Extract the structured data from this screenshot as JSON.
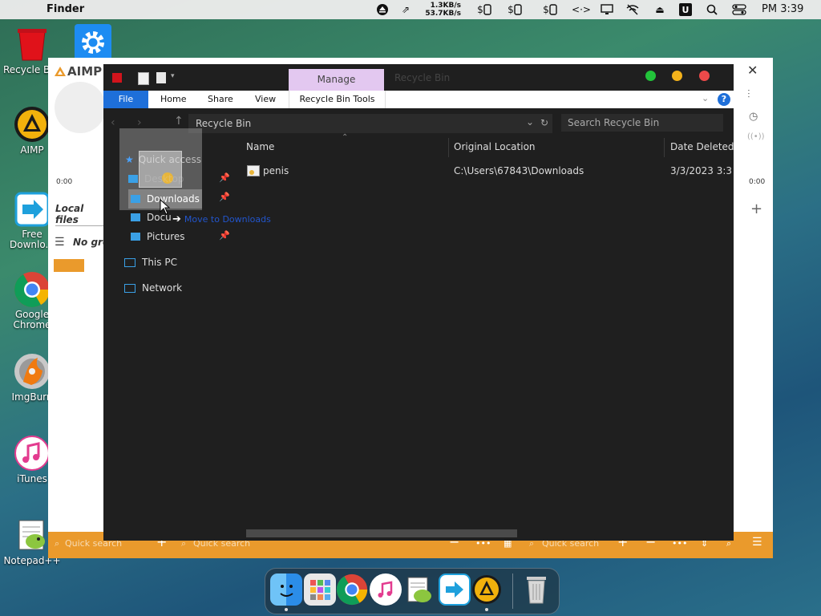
{
  "menubar": {
    "app_name": "Finder",
    "net_up": "1.3KB/s",
    "net_down": "53.7KB/s",
    "clock": "PM 3:39"
  },
  "desktop": {
    "icons": [
      {
        "label": "Recycle Bin"
      },
      {
        "label": "AIMP"
      },
      {
        "label": "Free Downlo..."
      },
      {
        "label": "Google Chrome"
      },
      {
        "label": "ImgBurn"
      },
      {
        "label": "iTunes"
      },
      {
        "label": "Notepad++"
      }
    ]
  },
  "aimp": {
    "logo": "AIMP",
    "time_left": "0:00",
    "time_right": "0:00",
    "local_files": "Local files",
    "no_group": "No gro",
    "quick_search_1": "Quick search",
    "quick_search_2": "Quick search",
    "quick_search_3": "Quick search"
  },
  "explorer": {
    "manage_tab": "Manage",
    "window_title": "Recycle Bin",
    "tabs": [
      "File",
      "Home",
      "Share",
      "View",
      "Recycle Bin Tools"
    ],
    "address": "Recycle Bin",
    "search_placeholder": "Search Recycle Bin",
    "nav": {
      "quick_access": "Quick access",
      "desktop": "Desktop",
      "downloads": "Downloads",
      "documents": "Docu",
      "pictures": "Pictures",
      "this_pc": "This PC",
      "network": "Network"
    },
    "drag_tooltip": "Move to Downloads",
    "columns": [
      "Name",
      "Original Location",
      "Date Deleted"
    ],
    "rows": [
      {
        "name": "penis",
        "location": "C:\\Users\\67843\\Downloads",
        "date": "3/3/2023 3:3"
      }
    ]
  },
  "colors": {
    "accent_orange": "#ea9a2c",
    "manage_purple": "#e3c8f0",
    "selected_blue": "#1e6fd9",
    "traffic_green": "#22c33a",
    "traffic_yellow": "#f3b21b",
    "traffic_red": "#ee4a4a"
  }
}
